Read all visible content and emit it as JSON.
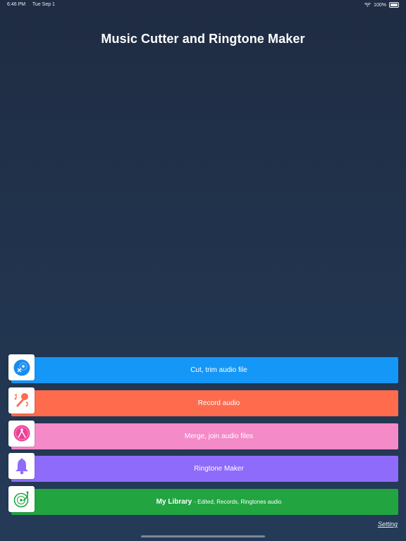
{
  "status": {
    "time": "6:46 PM",
    "date": "Tue Sep 1",
    "battery": "100%"
  },
  "app": {
    "title": "Music Cutter and Ringtone Maker"
  },
  "menu": {
    "items": [
      {
        "label": "Cut, trim audio file",
        "color": "#1597f8",
        "icon": "scissors-disc-icon"
      },
      {
        "label": "Record audio",
        "color": "#fe6b4d",
        "icon": "microphone-icon"
      },
      {
        "label": "Merge, join audio files",
        "color": "#f48ac8",
        "icon": "merge-icon"
      },
      {
        "label": "Ringtone Maker",
        "color": "#8e6bfa",
        "icon": "bell-icon"
      },
      {
        "label": "My Library",
        "sub": "- Edited, Records, Ringtones audio",
        "color": "#22a541",
        "icon": "turntable-icon"
      }
    ]
  },
  "footer": {
    "setting_label": "Setting"
  }
}
